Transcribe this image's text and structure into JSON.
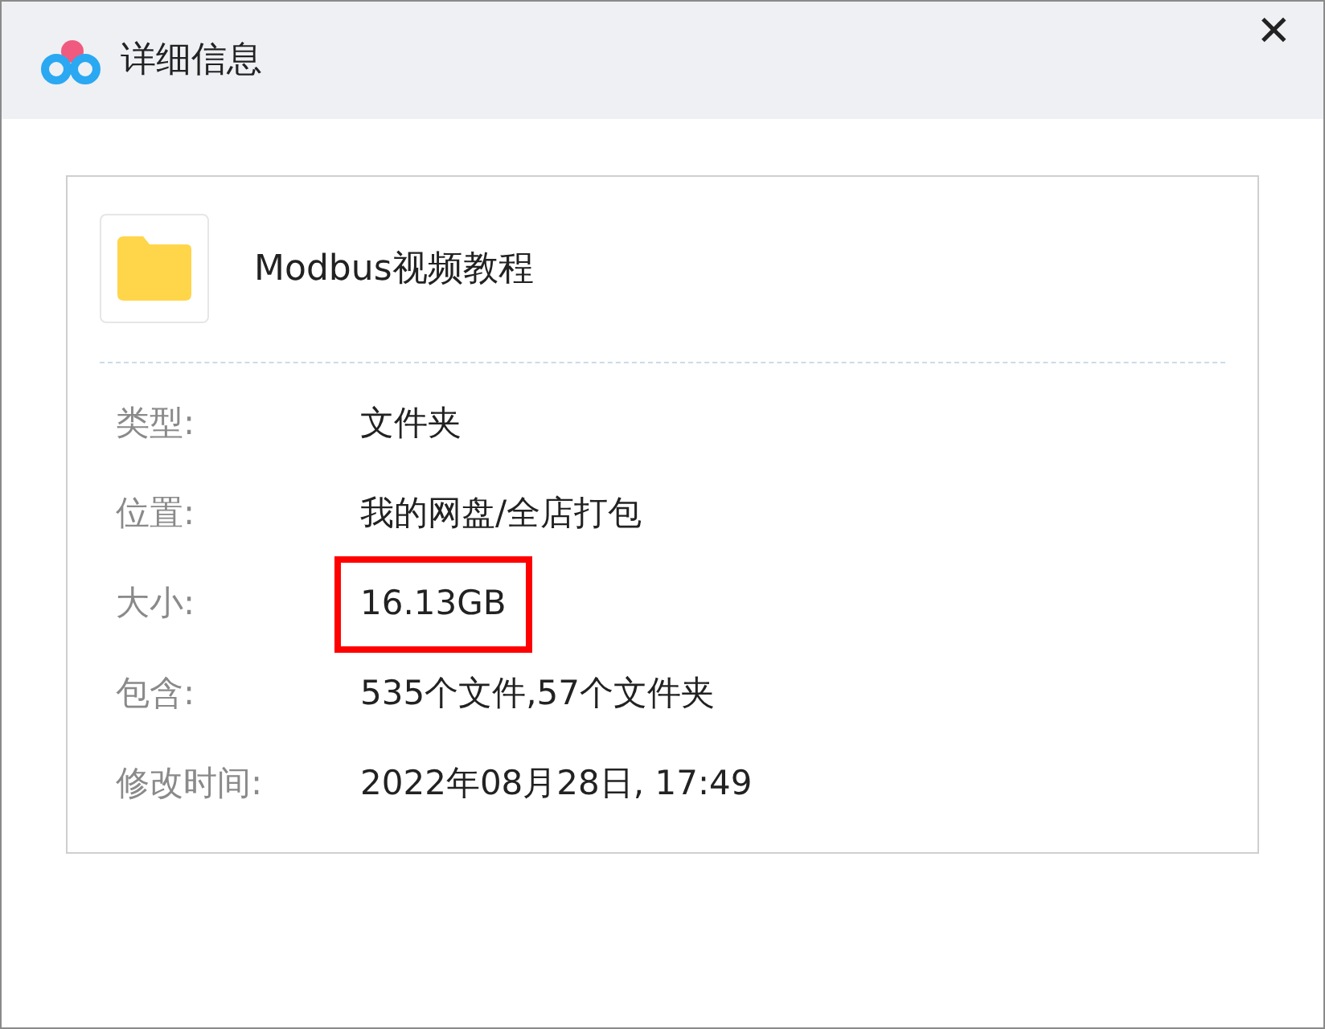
{
  "window": {
    "title": "详细信息",
    "close": "✕"
  },
  "file": {
    "name": "Modbus视频教程"
  },
  "details": [
    {
      "label": "类型:",
      "value": "文件夹",
      "highlighted": false
    },
    {
      "label": "位置:",
      "value": "我的网盘/全店打包",
      "highlighted": false
    },
    {
      "label": "大小:",
      "value": "16.13GB",
      "highlighted": true
    },
    {
      "label": "包含:",
      "value": "535个文件,57个文件夹",
      "highlighted": false
    },
    {
      "label": "修改时间:",
      "value": "2022年08月28日, 17:49",
      "highlighted": false
    }
  ]
}
